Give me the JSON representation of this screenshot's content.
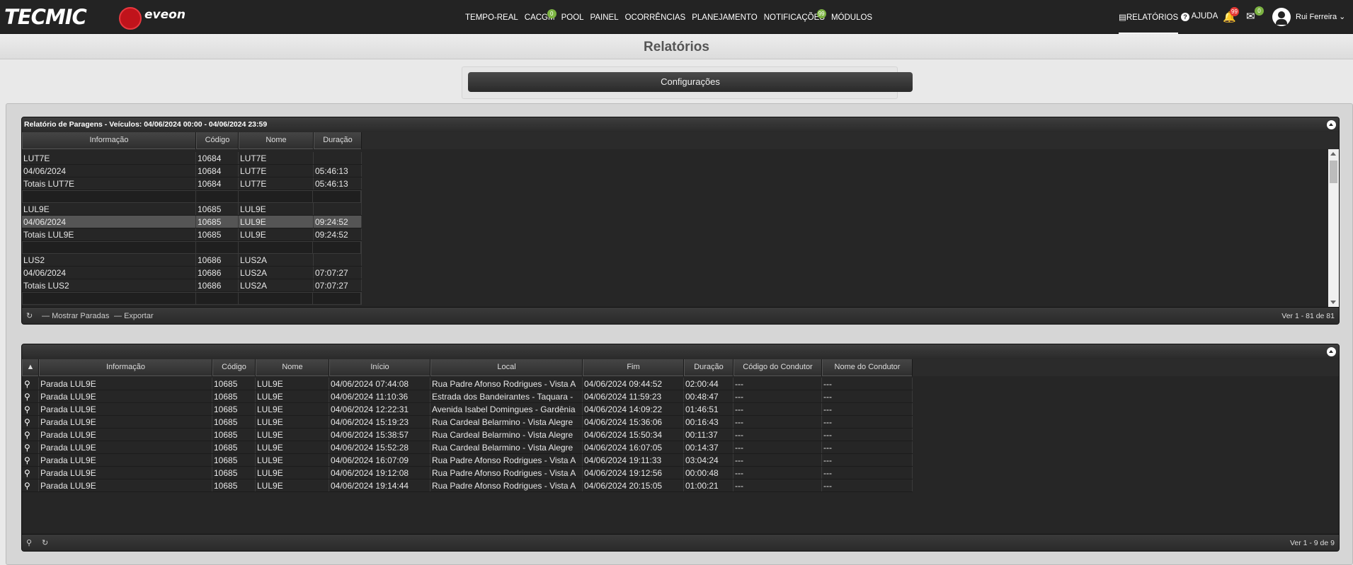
{
  "header": {
    "logo_left": "TECMIC",
    "logo_right": "eveon",
    "nav": [
      {
        "label": "TEMPO-REAL",
        "badge": ""
      },
      {
        "label": "CACGM",
        "badge": "0"
      },
      {
        "label": "POOL",
        "badge": ""
      },
      {
        "label": "PAINEL",
        "badge": ""
      },
      {
        "label": "OCORRÊNCIAS",
        "badge": ""
      },
      {
        "label": "PLANEJAMENTO",
        "badge": ""
      },
      {
        "label": "NOTIFICAÇÕES",
        "badge": "99"
      },
      {
        "label": "MÓDULOS",
        "badge": ""
      }
    ],
    "relatorios": "RELATÓRIOS",
    "ajuda": "AJUDA",
    "bell_badge": "99",
    "mail_badge": "0",
    "user": "Rui Ferreira"
  },
  "page_title": "Relatórios",
  "config_button": "Configurações",
  "top_panel": {
    "title": "Relatório de Paragens - Veículos: 04/06/2024 00:00 - 04/06/2024 23:59",
    "columns": [
      "Informação",
      "Código",
      "Nome",
      "Duração"
    ],
    "rows": [
      {
        "type": "row",
        "cells": [
          "LUT7E",
          "10684",
          "LUT7E",
          ""
        ]
      },
      {
        "type": "row",
        "cells": [
          "04/06/2024",
          "10684",
          "LUT7E",
          "05:46:13"
        ]
      },
      {
        "type": "row",
        "cells": [
          "Totais LUT7E",
          "10684",
          "LUT7E",
          "05:46:13"
        ]
      },
      {
        "type": "sep",
        "cells": [
          "",
          "",
          "",
          ""
        ]
      },
      {
        "type": "row",
        "cells": [
          "LUL9E",
          "10685",
          "LUL9E",
          ""
        ]
      },
      {
        "type": "sel",
        "cells": [
          "04/06/2024",
          "10685",
          "LUL9E",
          "09:24:52"
        ]
      },
      {
        "type": "row",
        "cells": [
          "Totais LUL9E",
          "10685",
          "LUL9E",
          "09:24:52"
        ]
      },
      {
        "type": "sep",
        "cells": [
          "",
          "",
          "",
          ""
        ]
      },
      {
        "type": "row",
        "cells": [
          "LUS2",
          "10686",
          "LUS2A",
          ""
        ]
      },
      {
        "type": "row",
        "cells": [
          "04/06/2024",
          "10686",
          "LUS2A",
          "07:07:27"
        ]
      },
      {
        "type": "row",
        "cells": [
          "Totais LUS2",
          "10686",
          "LUS2A",
          "07:07:27"
        ]
      },
      {
        "type": "sep",
        "cells": [
          "",
          "",
          "",
          ""
        ]
      }
    ],
    "footer": {
      "show_stops": "Mostrar Paradas",
      "export": "Exportar",
      "pager": "Ver 1 - 81 de 81"
    }
  },
  "bottom_panel": {
    "columns": [
      "Informação",
      "Código",
      "Nome",
      "Início",
      "Local",
      "Fim",
      "Duração",
      "Código do Condutor",
      "Nome do Condutor"
    ],
    "rows": [
      [
        "Parada LUL9E",
        "10685",
        "LUL9E",
        "04/06/2024 07:44:08",
        "Rua Padre Afonso Rodrigues - Vista A",
        "04/06/2024 09:44:52",
        "02:00:44",
        "---",
        "---"
      ],
      [
        "Parada LUL9E",
        "10685",
        "LUL9E",
        "04/06/2024 11:10:36",
        "Estrada dos Bandeirantes - Taquara -",
        "04/06/2024 11:59:23",
        "00:48:47",
        "---",
        "---"
      ],
      [
        "Parada LUL9E",
        "10685",
        "LUL9E",
        "04/06/2024 12:22:31",
        "Avenida Isabel Domingues - Gardênia",
        "04/06/2024 14:09:22",
        "01:46:51",
        "---",
        "---"
      ],
      [
        "Parada LUL9E",
        "10685",
        "LUL9E",
        "04/06/2024 15:19:23",
        "Rua Cardeal Belarmino - Vista Alegre",
        "04/06/2024 15:36:06",
        "00:16:43",
        "---",
        "---"
      ],
      [
        "Parada LUL9E",
        "10685",
        "LUL9E",
        "04/06/2024 15:38:57",
        "Rua Cardeal Belarmino - Vista Alegre",
        "04/06/2024 15:50:34",
        "00:11:37",
        "---",
        "---"
      ],
      [
        "Parada LUL9E",
        "10685",
        "LUL9E",
        "04/06/2024 15:52:28",
        "Rua Cardeal Belarmino - Vista Alegre",
        "04/06/2024 16:07:05",
        "00:14:37",
        "---",
        "---"
      ],
      [
        "Parada LUL9E",
        "10685",
        "LUL9E",
        "04/06/2024 16:07:09",
        "Rua Padre Afonso Rodrigues - Vista A",
        "04/06/2024 19:11:33",
        "03:04:24",
        "---",
        "---"
      ],
      [
        "Parada LUL9E",
        "10685",
        "LUL9E",
        "04/06/2024 19:12:08",
        "Rua Padre Afonso Rodrigues - Vista A",
        "04/06/2024 19:12:56",
        "00:00:48",
        "---",
        "---"
      ],
      [
        "Parada LUL9E",
        "10685",
        "LUL9E",
        "04/06/2024 19:14:44",
        "Rua Padre Afonso Rodrigues - Vista A",
        "04/06/2024 20:15:05",
        "01:00:21",
        "---",
        "---"
      ]
    ],
    "pager": "Ver 1 - 9 de 9"
  },
  "colors": {
    "topbar": "#232323",
    "badge_green": "#7cb342",
    "badge_red": "#e53935"
  }
}
